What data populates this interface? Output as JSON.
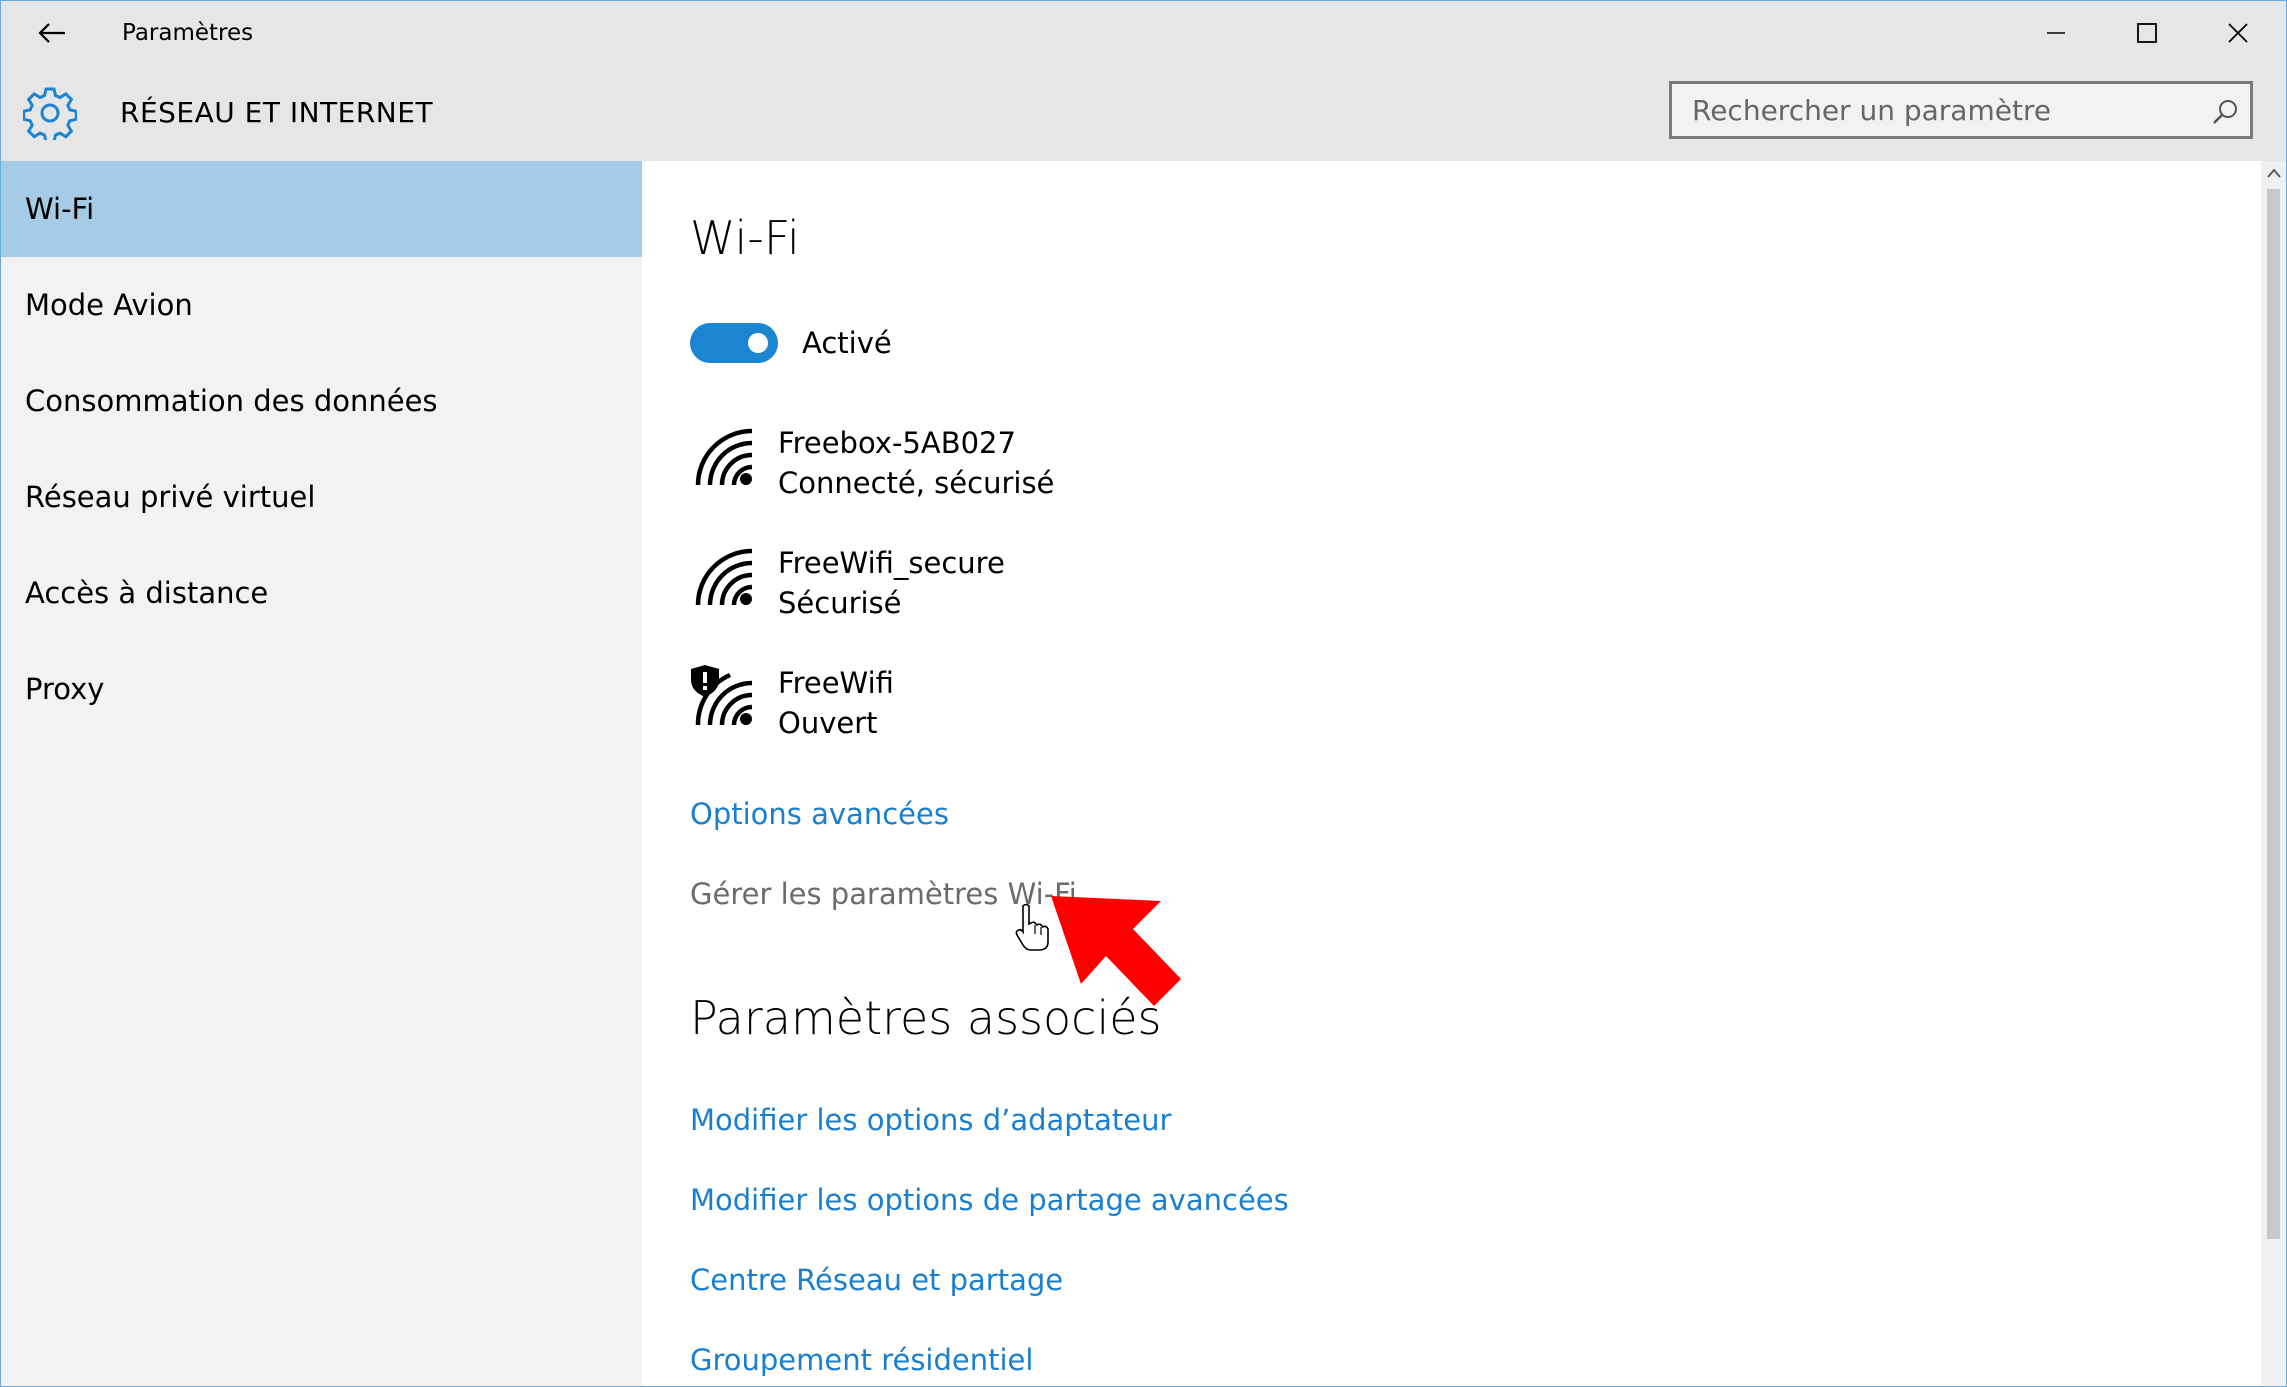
{
  "window": {
    "app_title": "Paramètres",
    "section_title": "RÉSEAU ET INTERNET",
    "accent_color": "#1c85d2",
    "link_color": "#1a7fcf"
  },
  "search": {
    "placeholder": "Rechercher un paramètre",
    "value": ""
  },
  "sidebar": {
    "items": [
      {
        "label": "Wi-Fi",
        "active": true
      },
      {
        "label": "Mode Avion"
      },
      {
        "label": "Consommation des données"
      },
      {
        "label": "Réseau privé virtuel"
      },
      {
        "label": "Accès à distance"
      },
      {
        "label": "Proxy"
      }
    ]
  },
  "main": {
    "title": "Wi-Fi",
    "toggle": {
      "state": "on",
      "label": "Activé"
    },
    "networks": [
      {
        "name": "Freebox-5AB027",
        "status": "Connecté, sécurisé",
        "icon": "wifi-signal-icon"
      },
      {
        "name": "FreeWifi_secure",
        "status": "Sécurisé",
        "icon": "wifi-signal-icon"
      },
      {
        "name": "FreeWifi",
        "status": "Ouvert",
        "icon": "wifi-open-warning-icon"
      }
    ],
    "advanced_options": "Options avancées",
    "manage_wifi": "Gérer les paramètres Wi-Fi",
    "related_title": "Paramètres associés",
    "related_links": [
      "Modifier les options d’adaptateur",
      "Modifier les options de partage avancées",
      "Centre Réseau et partage",
      "Groupement résidentiel"
    ]
  }
}
